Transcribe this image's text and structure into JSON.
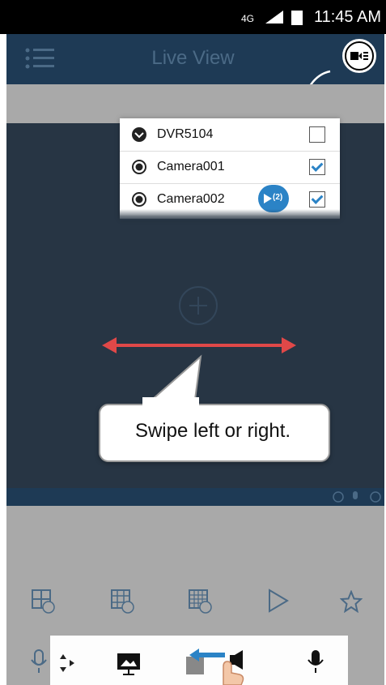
{
  "status_bar": {
    "time": "11:45 AM"
  },
  "header": {
    "title": "Live View"
  },
  "device_list": {
    "rows": [
      {
        "label": "DVR5104",
        "checked": false
      },
      {
        "label": "Camera001",
        "checked": true
      },
      {
        "label": "Camera002",
        "checked": true
      }
    ],
    "play_badge": "(2)"
  },
  "hint": {
    "text": "Swipe left or right."
  },
  "colors": {
    "header_bg": "#1e3a55",
    "view_bg": "#273544",
    "accent": "#2b83c6",
    "arrow": "#e04848"
  }
}
